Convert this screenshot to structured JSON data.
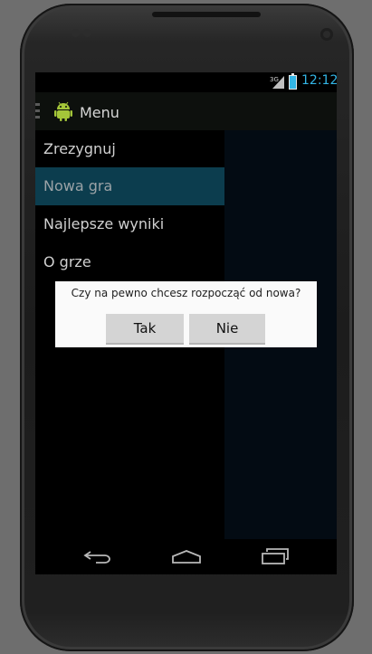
{
  "status_bar": {
    "network": "3G",
    "time": "12:12"
  },
  "action_bar": {
    "title": "Menu"
  },
  "drawer": {
    "items": [
      {
        "label": "Zrezygnuj"
      },
      {
        "label": "Nowa gra"
      },
      {
        "label": "Najlepsze wyniki"
      },
      {
        "label": "O grze"
      }
    ]
  },
  "dialog": {
    "message": "Czy na pewno chcesz rozpocząć od nowa?",
    "confirm_label": "Tak",
    "cancel_label": "Nie"
  },
  "colors": {
    "accent": "#33b5e5",
    "selected_item": "#0c3d4e"
  },
  "icons": {
    "app": "android-robot-icon",
    "back": "back-icon",
    "home": "home-icon",
    "recents": "recents-icon"
  }
}
